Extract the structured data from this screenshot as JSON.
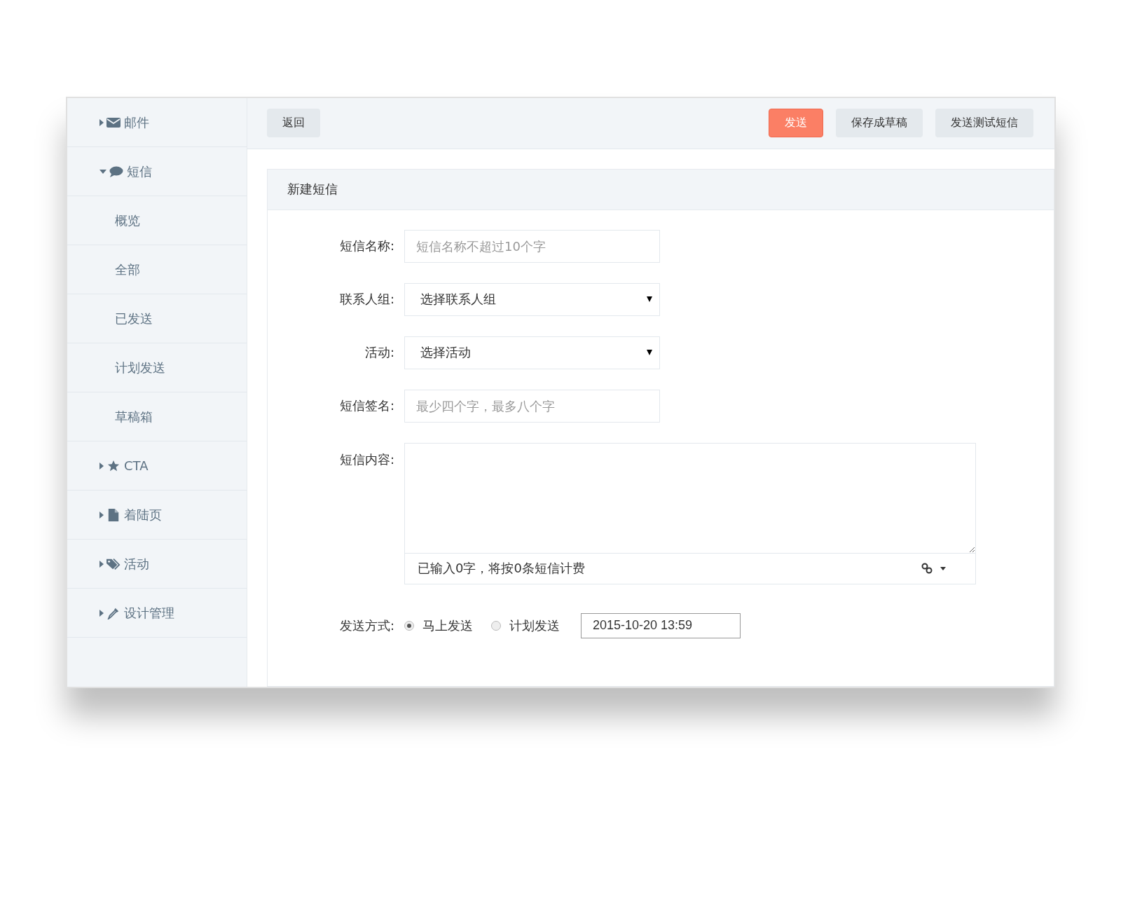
{
  "sidebar": {
    "items": [
      {
        "label": "邮件",
        "expanded": false
      },
      {
        "label": "短信",
        "expanded": true,
        "children": [
          {
            "label": "概览"
          },
          {
            "label": "全部"
          },
          {
            "label": "已发送"
          },
          {
            "label": "计划发送"
          },
          {
            "label": "草稿箱"
          }
        ]
      },
      {
        "label": "CTA",
        "expanded": false
      },
      {
        "label": "着陆页",
        "expanded": false
      },
      {
        "label": "活动",
        "expanded": false
      },
      {
        "label": "设计管理",
        "expanded": false
      }
    ]
  },
  "toolbar": {
    "back_button": "返回",
    "buttons": [
      {
        "label": "发送",
        "kind": "primary"
      },
      {
        "label": "保存成草稿",
        "kind": "default"
      },
      {
        "label": "发送测试短信",
        "kind": "default"
      }
    ]
  },
  "form": {
    "title": "新建短信",
    "fields": [
      {
        "kind": "text",
        "label": "短信名称:",
        "placeholder": "短信名称不超过10个字"
      },
      {
        "kind": "select",
        "label": "联系人组:",
        "value": "选择联系人组"
      },
      {
        "kind": "select",
        "label": "活动:",
        "value": "选择活动"
      },
      {
        "kind": "text",
        "label": "短信签名:",
        "placeholder": "最少四个字，最多八个字"
      },
      {
        "kind": "textarea",
        "label": "短信内容:",
        "counter": "已输入0字，将按0条短信计费"
      }
    ],
    "send_mode": {
      "label": "发送方式:",
      "options": [
        {
          "label": "马上发送",
          "selected": true
        },
        {
          "label": "计划发送",
          "selected": false
        }
      ],
      "datetime": "2015-10-20 13:59"
    }
  }
}
